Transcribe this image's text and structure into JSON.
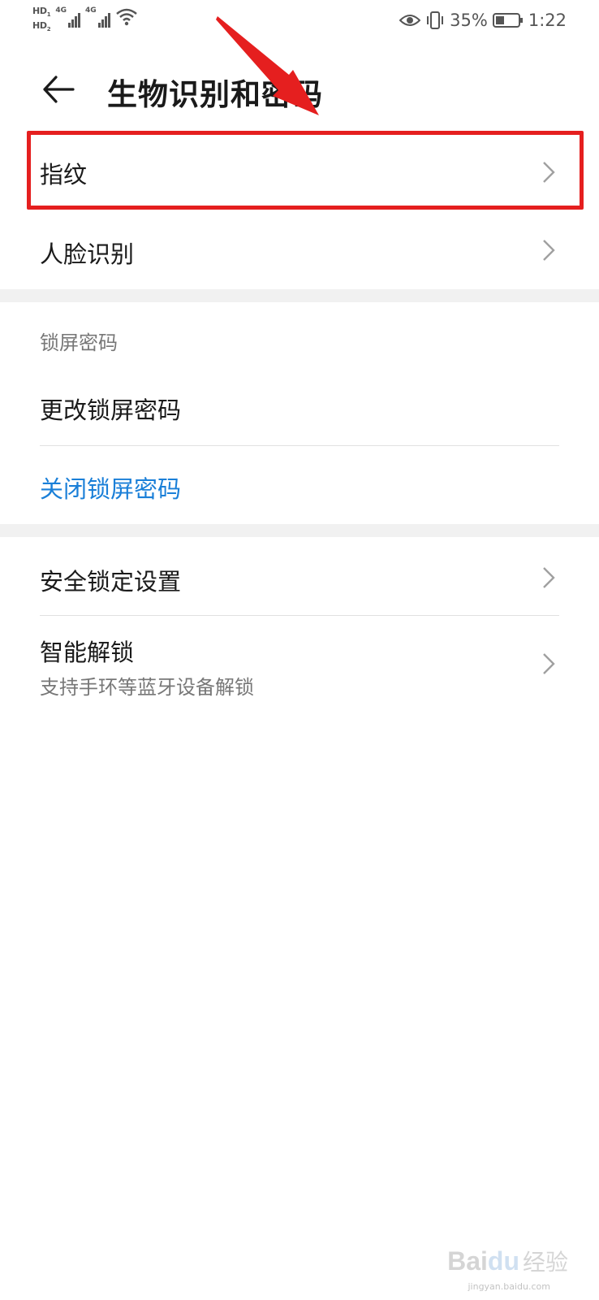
{
  "status_bar": {
    "hd1": "HD",
    "hd1_sub": "1",
    "hd2": "HD",
    "hd2_sub": "2",
    "net1": "4G",
    "net2": "4G",
    "battery": "35%",
    "time": "1:22",
    "icons": [
      "signal-icon",
      "wifi-icon",
      "eye-icon",
      "vibrate-icon",
      "battery-icon"
    ]
  },
  "header": {
    "title": "生物识别和密码"
  },
  "biometrics": [
    {
      "label": "指纹"
    },
    {
      "label": "人脸识别"
    }
  ],
  "lock_screen": {
    "section_label": "锁屏密码",
    "change_label": "更改锁屏密码",
    "disable_label": "关闭锁屏密码"
  },
  "security": {
    "lock_settings_label": "安全锁定设置",
    "smart_unlock_label": "智能解锁",
    "smart_unlock_desc": "支持手环等蓝牙设备解锁"
  },
  "watermark": {
    "brand": "Bai",
    "brand2": "du",
    "cn": "经验",
    "url": "jingyan.baidu.com"
  },
  "colors": {
    "accent": "#1a7fd8",
    "highlight": "#e51f1f",
    "section_gap": "#f1f1f1"
  }
}
